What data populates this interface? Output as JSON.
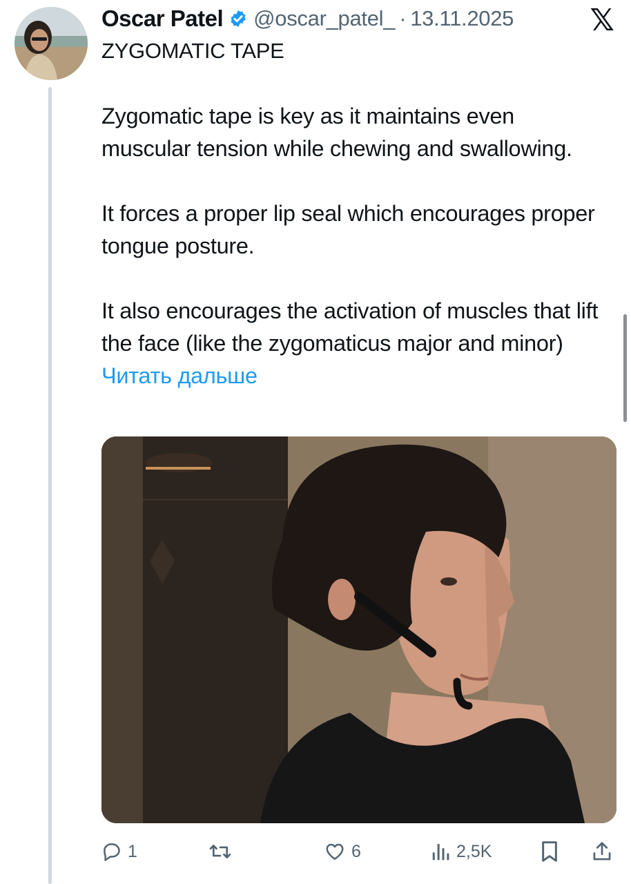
{
  "tweet": {
    "author_name": "Oscar Patel",
    "handle": "@oscar_patel_",
    "separator": "·",
    "date": "13.11.2025",
    "title": "ZYGOMATIC TAPE",
    "paragraphs": [
      "Zygomatic tape is key as it maintains even muscular tension while chewing and swallowing.",
      "It forces a proper lip seal which encourages proper tongue posture.",
      "It also encourages the activation of muscles that lift the face (like the zygomaticus major and minor)"
    ],
    "read_more": "Читать дальше"
  },
  "actions": {
    "replies": "1",
    "reposts": "",
    "likes": "6",
    "views": "2,5K"
  },
  "icons": {
    "verified": "verified-badge-icon",
    "platform": "x-logo-icon",
    "reply": "reply-icon",
    "repost": "repost-icon",
    "like": "heart-icon",
    "views": "views-icon",
    "bookmark": "bookmark-icon",
    "share": "share-icon"
  },
  "colors": {
    "text": "#0f1419",
    "secondary": "#536471",
    "link": "#1d9bf0",
    "thread_line": "#cfd9de"
  }
}
